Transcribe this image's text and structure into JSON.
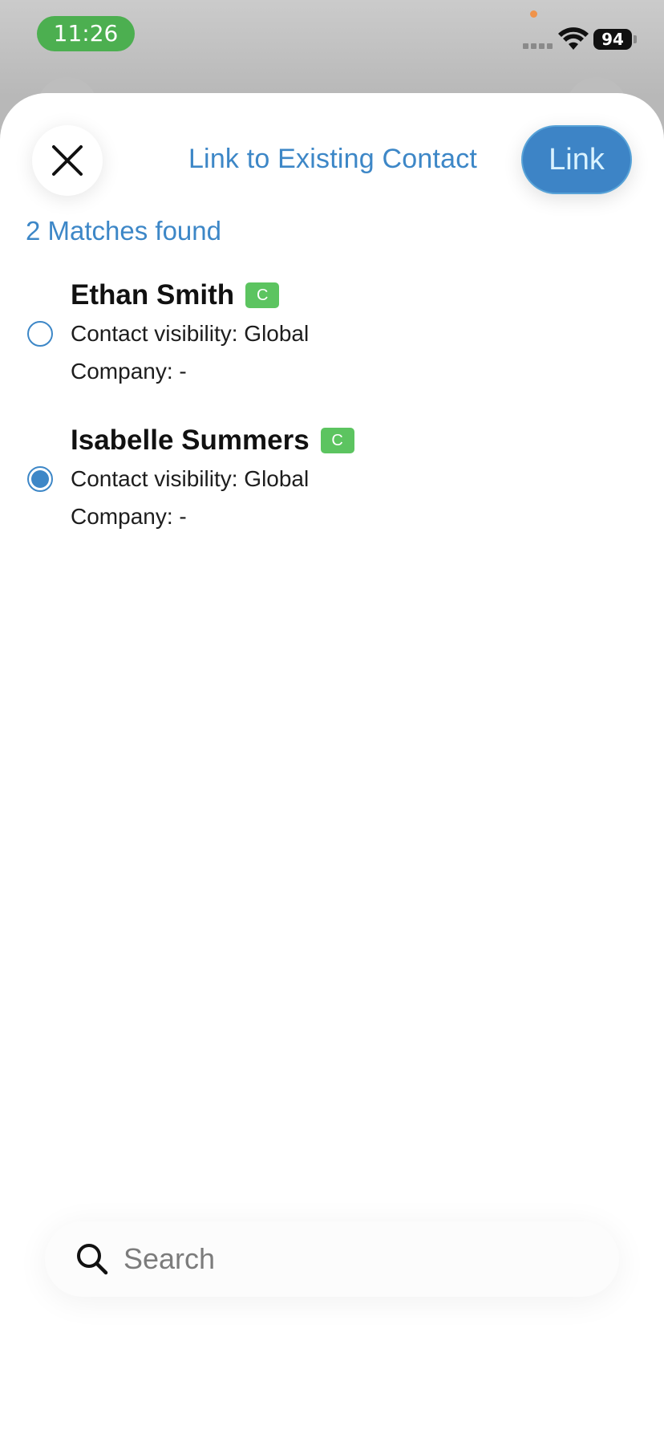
{
  "status_bar": {
    "time": "11:26",
    "battery": "94",
    "colors": {
      "time_pill": "#4caf50",
      "privacy_dot": "#f0934a"
    }
  },
  "header": {
    "title": "Link to Existing Contact",
    "link_label": "Link",
    "close_icon": "close-icon"
  },
  "matches_label": "2 Matches found",
  "contacts": [
    {
      "name": "Ethan Smith",
      "badge": "C",
      "visibility": "Contact visibility: Global",
      "company": "Company: -",
      "selected": false
    },
    {
      "name": "Isabelle Summers",
      "badge": "C",
      "visibility": "Contact visibility: Global",
      "company": "Company: -",
      "selected": true
    }
  ],
  "search": {
    "placeholder": "Search",
    "icon": "search-icon"
  },
  "colors": {
    "accent": "#3d87c7",
    "badge": "#5cc460",
    "link_button": "#3d84c6"
  }
}
